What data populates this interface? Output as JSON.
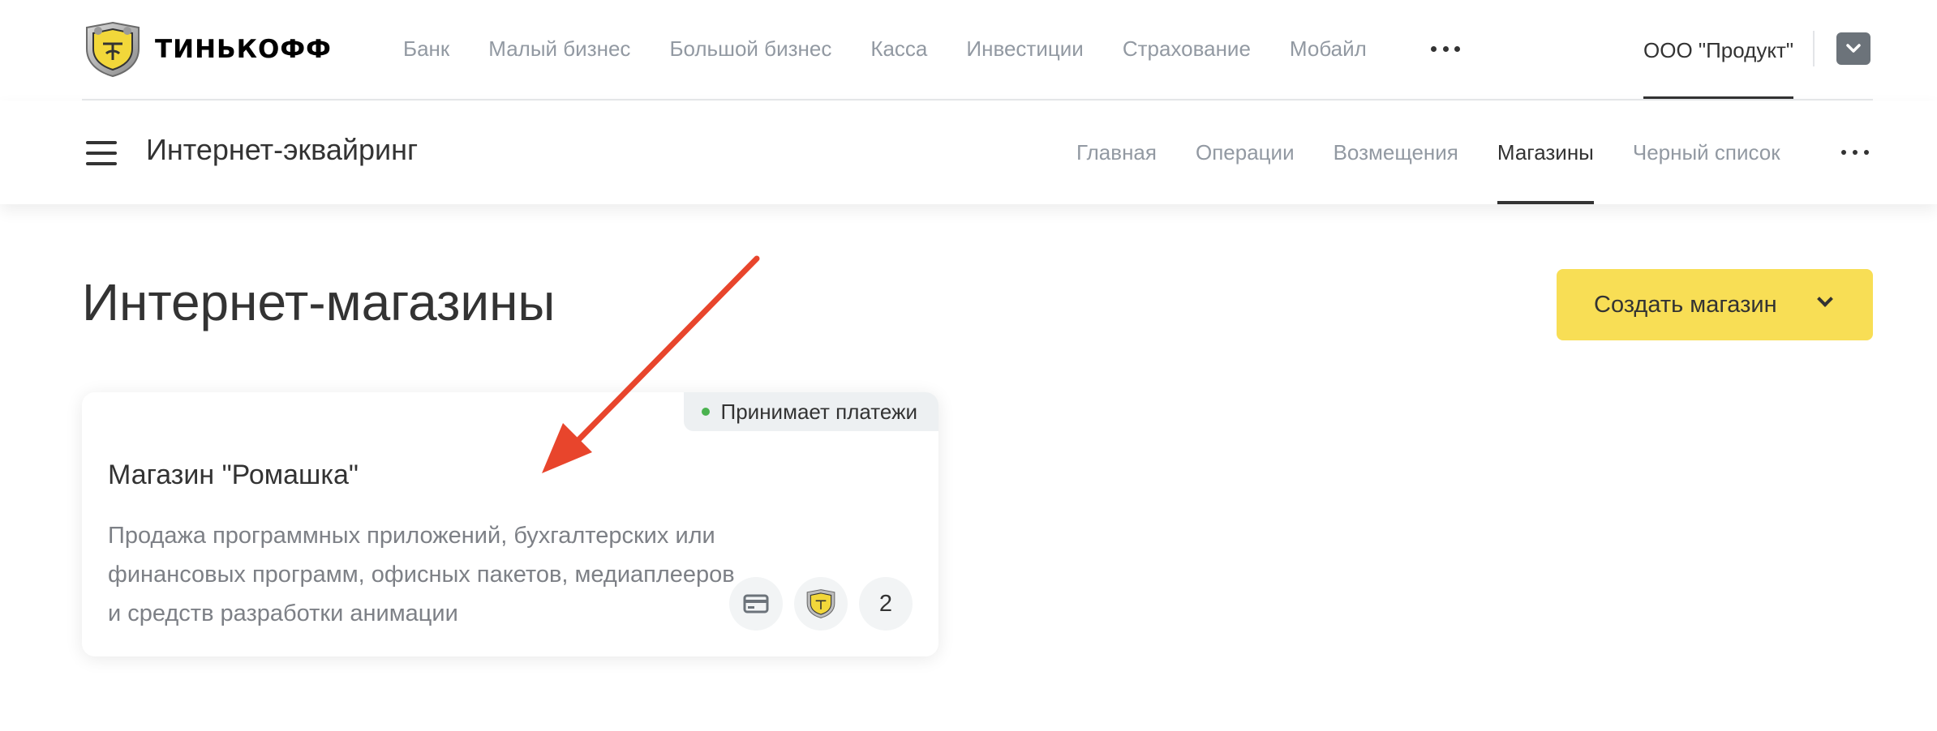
{
  "header": {
    "logo_icon": "tinkoff-emblem-icon",
    "logo_text": "ТИНЬКОФФ",
    "nav": [
      "Банк",
      "Малый бизнес",
      "Большой бизнес",
      "Касса",
      "Инвестиции",
      "Страхование",
      "Мобайл"
    ],
    "more_icon": "more-dots-icon",
    "org_name": "ООО \"Продукт\"",
    "profile_icon": "chevron-down-icon"
  },
  "subheader": {
    "menu_icon": "hamburger-icon",
    "title": "Интернет-эквайринг",
    "tabs": [
      "Главная",
      "Операции",
      "Возмещения",
      "Магазины",
      "Черный список"
    ],
    "active_tab": "Магазины",
    "more_icon": "more-dots-icon"
  },
  "main": {
    "title": "Интернет-магазины",
    "create_button": "Создать магазин",
    "create_button_icon": "chevron-down-icon"
  },
  "shop": {
    "status": "Принимает платежи",
    "name": "Магазин \"Ромашка\"",
    "description": "Продажа программных приложений, бухгалтерских или финансовых программ, офисных пакетов, медиаплееров и средств разработки анимации",
    "icons": [
      "card-icon",
      "tinkoff-emblem-icon"
    ],
    "extra_count": "2"
  },
  "colors": {
    "accent": "#f8de55",
    "status_green": "#4ab24f",
    "arrow": "#e8452c",
    "muted_text": "#9299a2"
  }
}
